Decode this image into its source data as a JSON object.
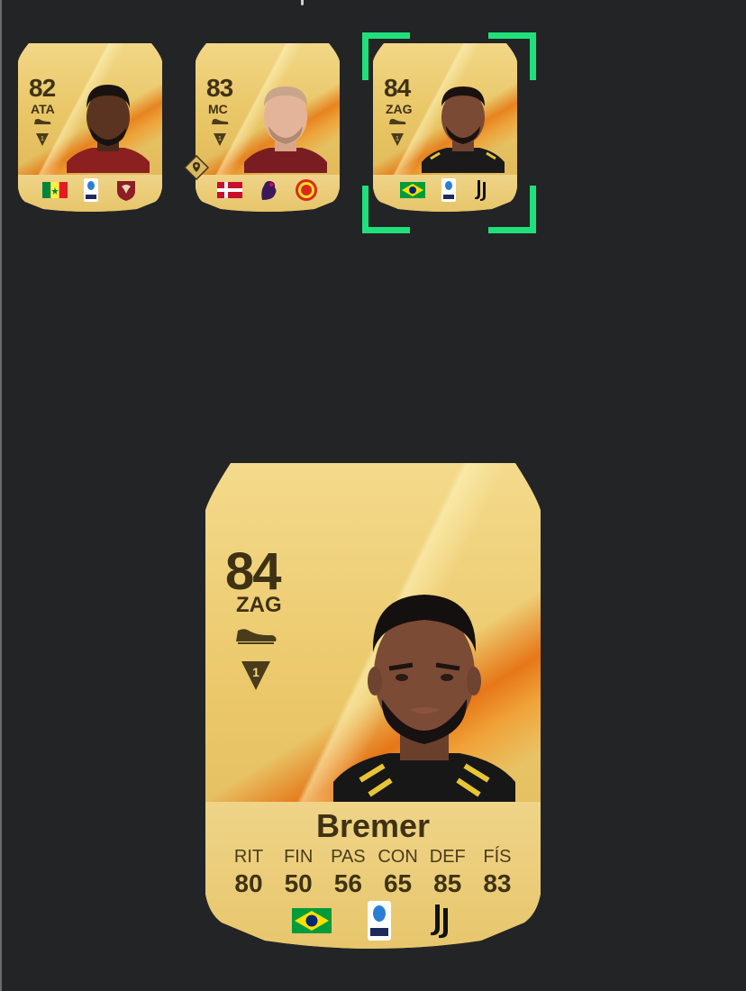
{
  "colors": {
    "background": "#232426",
    "card_gold": "#e8c565",
    "card_text": "#3f3214",
    "selection": "#1fe07a",
    "accent_orange": "#e6781a"
  },
  "cards": [
    {
      "rating": "82",
      "position": "ATA",
      "chemistry": "1",
      "nation_icon": "senegal-flag-icon",
      "league_icon": "serie-a-logo-icon",
      "club_icon": "salernitana-crest-icon"
    },
    {
      "rating": "83",
      "position": "MC",
      "chemistry": "1",
      "nation_icon": "denmark-flag-icon",
      "league_icon": "premier-league-logo-icon",
      "club_icon": "manchester-united-crest-icon",
      "marker_icon": "location-pin-icon"
    },
    {
      "rating": "84",
      "position": "ZAG",
      "chemistry": "1",
      "nation_icon": "brazil-flag-icon",
      "league_icon": "serie-a-logo-icon",
      "club_icon": "juventus-crest-icon",
      "selected": true
    }
  ],
  "detail": {
    "rating": "84",
    "position": "ZAG",
    "chemistry": "1",
    "name": "Bremer",
    "stats": [
      {
        "label": "RIT",
        "value": "80"
      },
      {
        "label": "FIN",
        "value": "50"
      },
      {
        "label": "PAS",
        "value": "56"
      },
      {
        "label": "CON",
        "value": "65"
      },
      {
        "label": "DEF",
        "value": "85"
      },
      {
        "label": "FÍS",
        "value": "83"
      }
    ],
    "nation_icon": "brazil-flag-icon",
    "league_icon": "serie-a-logo-icon",
    "club_icon": "juventus-crest-icon"
  }
}
